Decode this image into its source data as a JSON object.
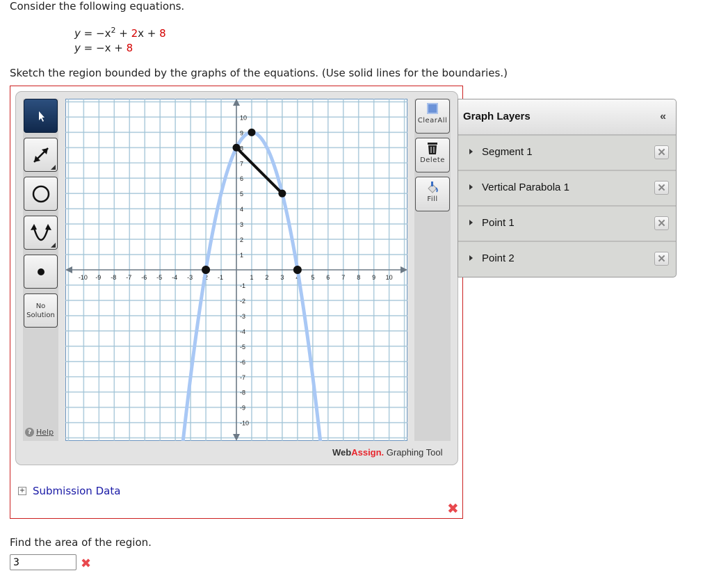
{
  "question": {
    "intro": "Consider the following equations.",
    "equations": [
      {
        "lhs": "y",
        "parts": [
          "−x",
          "2",
          " + ",
          "2",
          "x + ",
          "8"
        ]
      },
      {
        "lhs": "y",
        "parts": [
          "−x + ",
          "8"
        ]
      }
    ],
    "instruction": "Sketch the region bounded by the graphs of the equations. (Use solid lines for the boundaries.)",
    "area_prompt": "Find the area of the region.",
    "area_answer": "3",
    "area_status": "incorrect"
  },
  "toolbar_left": {
    "tools": [
      {
        "name": "select",
        "icon": "arrow-pointer-icon",
        "active": true
      },
      {
        "name": "line",
        "icon": "line-arrow-icon",
        "active": false
      },
      {
        "name": "circle",
        "icon": "circle-icon",
        "active": false
      },
      {
        "name": "parabola",
        "icon": "parabola-icon",
        "active": false
      },
      {
        "name": "point",
        "icon": "point-icon",
        "active": false
      }
    ],
    "no_solution_line1": "No",
    "no_solution_line2": "Solution",
    "help_label": "Help"
  },
  "toolbar_right": {
    "clear_all": "ClearAll",
    "delete": "Delete",
    "fill": "Fill"
  },
  "branding": {
    "web": "Web",
    "assign": "Assign.",
    "rest": " Graphing Tool"
  },
  "graph_layers": {
    "title": "Graph Layers",
    "collapse": "«",
    "items": [
      {
        "label": "Segment 1"
      },
      {
        "label": "Vertical Parabola 1"
      },
      {
        "label": "Point 1"
      },
      {
        "label": "Point 2"
      }
    ]
  },
  "submission_data": "Submission Data",
  "graph_status": "incorrect",
  "colors": {
    "accent_red": "#d40000",
    "error_x": "#e8484d",
    "parabola": "#a9c8f5",
    "grid": "#9fc3d6",
    "axis": "#6d7a86"
  },
  "chart_data": {
    "type": "line",
    "xlim": [
      -11.2,
      11.2
    ],
    "ylim": [
      -11.2,
      11.2
    ],
    "x_ticks": [
      -10,
      -9,
      -8,
      -7,
      -6,
      -5,
      -4,
      -3,
      -2,
      -1,
      1,
      2,
      3,
      4,
      5,
      6,
      7,
      8,
      9,
      10
    ],
    "y_ticks": [
      10,
      9,
      8,
      7,
      6,
      5,
      4,
      3,
      2,
      1,
      -1,
      -2,
      -3,
      -4,
      -5,
      -6,
      -7,
      -8,
      -9,
      -10
    ],
    "grid": true,
    "series": [
      {
        "name": "Vertical Parabola 1",
        "kind": "parabola",
        "vertex": [
          1,
          9
        ],
        "a": -1,
        "x_range": [
          -3.5,
          5.5
        ]
      },
      {
        "name": "Segment 1",
        "kind": "segment",
        "points": [
          [
            0,
            8
          ],
          [
            3,
            5
          ]
        ]
      },
      {
        "name": "Point 1",
        "kind": "point",
        "points": [
          [
            -2,
            0
          ]
        ]
      },
      {
        "name": "Point 2",
        "kind": "point",
        "points": [
          [
            4,
            0
          ]
        ]
      }
    ],
    "parabola_points": [
      [
        1,
        9
      ]
    ]
  }
}
